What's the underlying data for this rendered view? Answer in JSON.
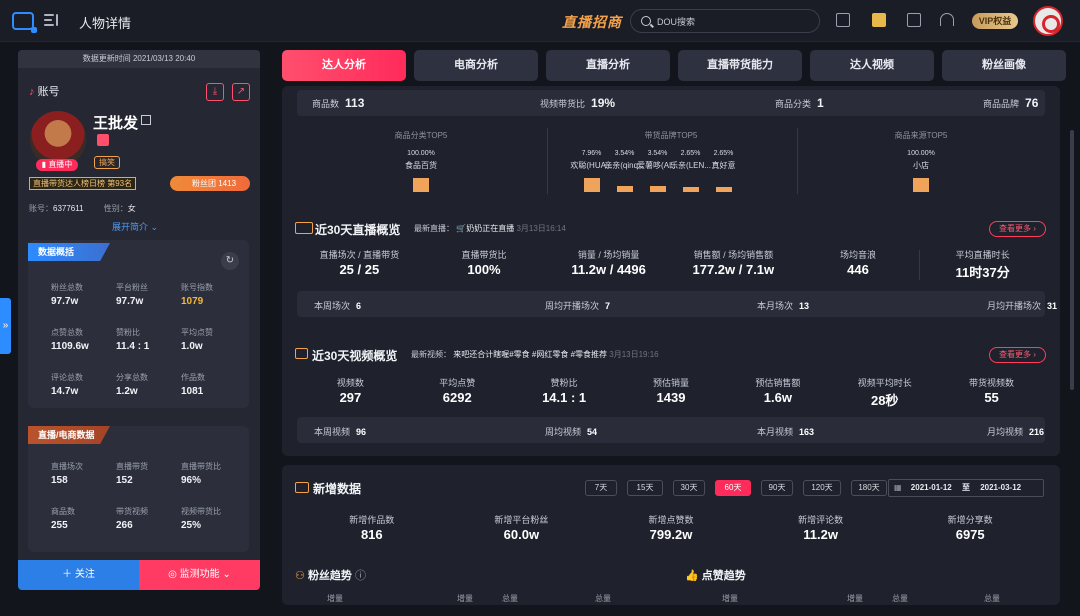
{
  "header": {
    "title": "人物详情",
    "brand": "直播招商",
    "search_placeholder": "DOU搜索",
    "vip": "VIP权益"
  },
  "profile": {
    "update_time": "数据更新时间 2021/03/13 20:40",
    "section": "账号",
    "name": "王批发",
    "live_badge": "直播中",
    "tag": "搞笑",
    "rank": "直播带货达人榜日榜 第93名",
    "fan_group": "粉丝团 1413",
    "account_label": "账号：",
    "account": "6377611",
    "gender_label": "性别：",
    "gender": "女",
    "expand": "展开简介"
  },
  "overview": {
    "title": "数据概括",
    "items": [
      {
        "label": "粉丝总数",
        "value": "97.7w"
      },
      {
        "label": "平台粉丝",
        "value": "97.7w"
      },
      {
        "label": "账号指数",
        "value": "1079"
      },
      {
        "label": "点赞总数",
        "value": "1109.6w"
      },
      {
        "label": "赞粉比",
        "value": "11.4 : 1"
      },
      {
        "label": "平均点赞",
        "value": "1.0w"
      },
      {
        "label": "评论总数",
        "value": "14.7w"
      },
      {
        "label": "分享总数",
        "value": "1.2w"
      },
      {
        "label": "作品数",
        "value": "1081"
      }
    ]
  },
  "live_ecom": {
    "title": "直播/电商数据",
    "items": [
      {
        "label": "直播场次",
        "value": "158"
      },
      {
        "label": "直播带货",
        "value": "152"
      },
      {
        "label": "直播带货比",
        "value": "96%"
      },
      {
        "label": "商品数",
        "value": "255"
      },
      {
        "label": "带货视频",
        "value": "266"
      },
      {
        "label": "视频带货比",
        "value": "25%"
      }
    ]
  },
  "actions": {
    "follow": "关注",
    "monitor": "监测功能"
  },
  "tabs": [
    "达人分析",
    "电商分析",
    "直播分析",
    "直播带货能力",
    "达人视频",
    "粉丝画像"
  ],
  "goods": {
    "items": [
      {
        "label": "商品数",
        "value": "113"
      },
      {
        "label": "视频带货比",
        "value": "19%"
      },
      {
        "label": "商品分类",
        "value": "1"
      },
      {
        "label": "商品品牌",
        "value": "76"
      }
    ],
    "top5": [
      {
        "title": "商品分类TOP5",
        "bars": [
          {
            "pct": "100.00%",
            "name": "食品百货",
            "frac": 1.0
          }
        ]
      },
      {
        "title": "带货品牌TOP5",
        "bars": [
          {
            "pct": "7.96%",
            "name": "欢聪(HUA...",
            "frac": 0.0796
          },
          {
            "pct": "3.54%",
            "name": "亲亲(qinq...",
            "frac": 0.0354
          },
          {
            "pct": "3.54%",
            "name": "爱薯哆(AI...",
            "frac": 0.0354
          },
          {
            "pct": "2.65%",
            "name": "乐亲(LEN...",
            "frac": 0.0265
          },
          {
            "pct": "2.65%",
            "name": "真好意",
            "frac": 0.0265
          }
        ]
      },
      {
        "title": "商品来源TOP5",
        "bars": [
          {
            "pct": "100.00%",
            "name": "小店",
            "frac": 1.0
          }
        ]
      }
    ]
  },
  "live30": {
    "title": "近30天直播概览",
    "latest_label": "最新直播：",
    "latest": "奶奶正在直播",
    "latest_time": "3月13日16:14",
    "more": "查看更多",
    "stats": [
      {
        "label": "直播场次 / 直播带货",
        "value": "25 / 25"
      },
      {
        "label": "直播带货比",
        "value": "100%"
      },
      {
        "label": "销量 / 场均销量",
        "value": "11.2w / 4496"
      },
      {
        "label": "销售额 / 场均销售额",
        "value": "177.2w / 7.1w"
      },
      {
        "label": "场均音浪",
        "value": "446"
      },
      {
        "label": "平均直播时长",
        "value": "11时37分"
      }
    ],
    "sub": [
      {
        "label": "本周场次",
        "value": "6"
      },
      {
        "label": "周均开播场次",
        "value": "7"
      },
      {
        "label": "本月场次",
        "value": "13"
      },
      {
        "label": "月均开播场次",
        "value": "31"
      }
    ]
  },
  "video30": {
    "title": "近30天视频概览",
    "latest_label": "最新视频：",
    "latest": "来吧还合计瞎喔#零食 #网红零食 #零食推荐",
    "latest_time": "3月13日19:16",
    "more": "查看更多",
    "stats": [
      {
        "label": "视频数",
        "value": "297"
      },
      {
        "label": "平均点赞",
        "value": "6292"
      },
      {
        "label": "赞粉比",
        "value": "14.1 : 1"
      },
      {
        "label": "预估销量",
        "value": "1439"
      },
      {
        "label": "预估销售额",
        "value": "1.6w"
      },
      {
        "label": "视频平均时长",
        "value": "28秒"
      },
      {
        "label": "带货视频数",
        "value": "55"
      }
    ],
    "sub": [
      {
        "label": "本周视频",
        "value": "96"
      },
      {
        "label": "周均视频",
        "value": "54"
      },
      {
        "label": "本月视频",
        "value": "163"
      },
      {
        "label": "月均视频",
        "value": "216"
      }
    ]
  },
  "newdata": {
    "title": "新增数据",
    "ranges": [
      "7天",
      "15天",
      "30天",
      "60天",
      "90天",
      "120天",
      "180天"
    ],
    "active": "60天",
    "date_from": "2021-01-12",
    "date_sep": "至",
    "date_to": "2021-03-12",
    "stats": [
      {
        "label": "新增作品数",
        "value": "816"
      },
      {
        "label": "新增平台粉丝",
        "value": "60.0w"
      },
      {
        "label": "新增点赞数",
        "value": "799.2w"
      },
      {
        "label": "新增评论数",
        "value": "11.2w"
      },
      {
        "label": "新增分享数",
        "value": "6975"
      }
    ],
    "fans_trend": "粉丝趋势",
    "likes_trend": "点赞趋势",
    "legend": {
      "inc": "增量",
      "total": "总量"
    }
  },
  "colors": {
    "accent": "#ff2b5b",
    "gold": "#f4a24a",
    "blue": "#2d8cff"
  }
}
